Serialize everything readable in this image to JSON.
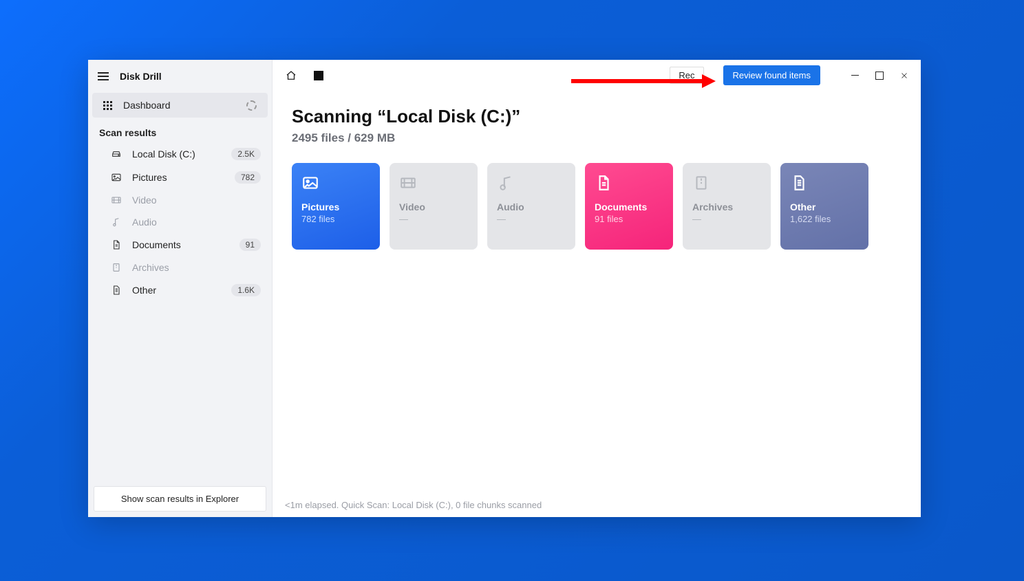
{
  "app": {
    "title": "Disk Drill"
  },
  "sidebar": {
    "dashboard_label": "Dashboard",
    "section_label": "Scan results",
    "items": [
      {
        "label": "Local Disk (C:)",
        "badge": "2.5K"
      },
      {
        "label": "Pictures",
        "badge": "782"
      },
      {
        "label": "Video",
        "badge": ""
      },
      {
        "label": "Audio",
        "badge": ""
      },
      {
        "label": "Documents",
        "badge": "91"
      },
      {
        "label": "Archives",
        "badge": ""
      },
      {
        "label": "Other",
        "badge": "1.6K"
      }
    ],
    "explorer_button": "Show scan results in Explorer"
  },
  "header": {
    "rec_label": "Rec",
    "review_button": "Review found items"
  },
  "main": {
    "title": "Scanning “Local Disk (C:)”",
    "subtitle": "2495 files / 629 MB"
  },
  "cards": [
    {
      "title": "Pictures",
      "sub": "782 files"
    },
    {
      "title": "Video",
      "sub": "—"
    },
    {
      "title": "Audio",
      "sub": "—"
    },
    {
      "title": "Documents",
      "sub": "91 files"
    },
    {
      "title": "Archives",
      "sub": "—"
    },
    {
      "title": "Other",
      "sub": "1,622 files"
    }
  ],
  "status": "<1m elapsed. Quick Scan: Local Disk (C:), 0 file chunks scanned"
}
